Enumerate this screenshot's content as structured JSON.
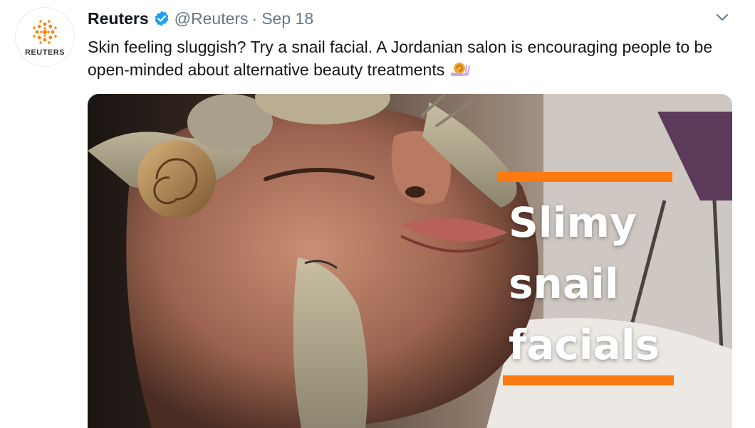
{
  "tweet": {
    "author_name": "Reuters",
    "handle": "@Reuters",
    "separator": "·",
    "date": "Sep 18",
    "avatar_label": "REUTERS",
    "text": "Skin feeling sluggish? Try a snail facial. A Jordanian salon is encouraging people to be open-minded about alternative beauty treatments",
    "emoji": "snail-emoji"
  },
  "media": {
    "caption_lines": [
      "Slimy",
      "snail",
      "facials"
    ],
    "accent_color": "#ff7a10"
  },
  "colors": {
    "verified": "#1da1f2",
    "brand_orange": "#ff8000",
    "muted": "#657786"
  }
}
